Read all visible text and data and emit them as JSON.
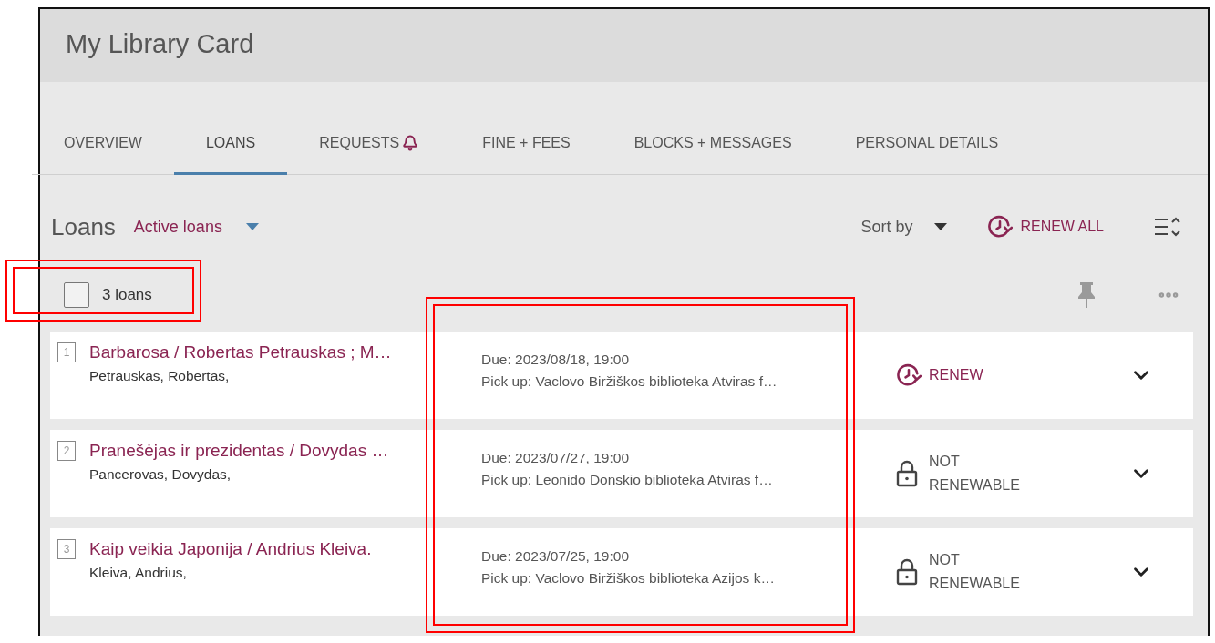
{
  "header": {
    "title": "My Library Card"
  },
  "tabs": [
    {
      "label": "OVERVIEW",
      "selected": false,
      "alert": false
    },
    {
      "label": "LOANS",
      "selected": true,
      "alert": false
    },
    {
      "label": "REQUESTS",
      "selected": false,
      "alert": true
    },
    {
      "label": "FINE + FEES",
      "selected": false,
      "alert": false
    },
    {
      "label": "BLOCKS + MESSAGES",
      "selected": false,
      "alert": false
    },
    {
      "label": "PERSONAL DETAILS",
      "selected": false,
      "alert": false
    }
  ],
  "toolbar": {
    "heading": "Loans",
    "filter": "Active loans",
    "sort": "Sort by",
    "renew_all": "RENEW ALL"
  },
  "selection": {
    "checked": false,
    "count": "3 loans"
  },
  "loans": [
    {
      "index": "1",
      "title": "Barbarosa / Robertas Petrauskas ; M…",
      "author": "Petrauskas, Robertas,",
      "due": "Due: 2023/08/18, 19:00",
      "pickup": "Pick up: Vaclovo Biržiškos biblioteka Atviras f…",
      "renew": {
        "kind": "renewable",
        "label": "RENEW"
      }
    },
    {
      "index": "2",
      "title": "Pranešėjas ir prezidentas / Dovydas …",
      "author": "Pancerovas, Dovydas,",
      "due": "Due: 2023/07/27, 19:00",
      "pickup": "Pick up: Leonido Donskio biblioteka Atviras f…",
      "renew": {
        "kind": "locked",
        "label": "NOT RENEWABLE"
      }
    },
    {
      "index": "3",
      "title": "Kaip veikia Japonija / Andrius Kleiva.",
      "author": "Kleiva, Andrius,",
      "due": "Due: 2023/07/25, 19:00",
      "pickup": "Pick up: Vaclovo Biržiškos biblioteka Azijos k…",
      "renew": {
        "kind": "locked",
        "label": "NOT RENEWABLE"
      }
    }
  ],
  "highlights": {
    "count_framed": true,
    "dates_framed": true
  }
}
